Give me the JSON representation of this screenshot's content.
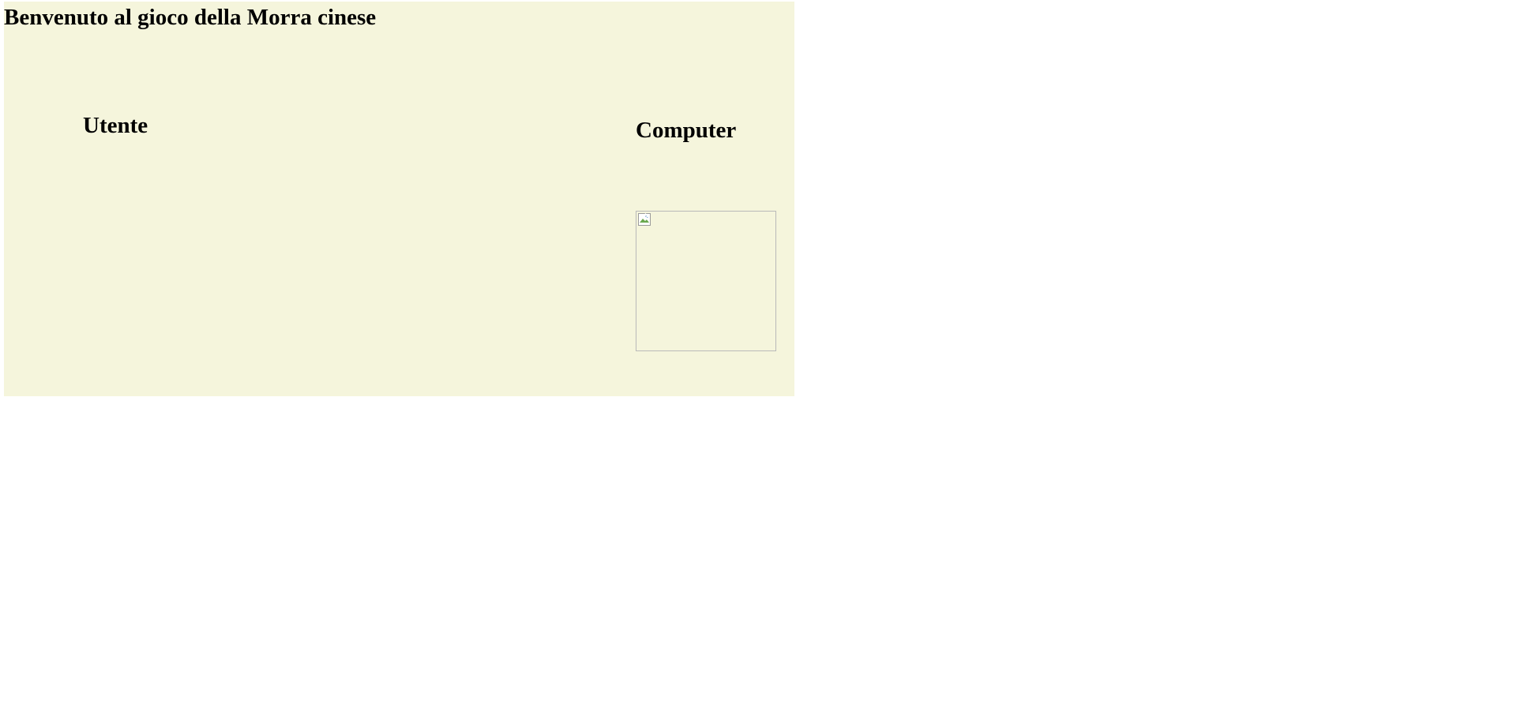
{
  "page": {
    "title": "Benvenuto al gioco della Morra cinese",
    "background_color": "#f5f5dc"
  },
  "player": {
    "heading": "Utente"
  },
  "computer": {
    "heading": "Computer",
    "choice_image_icon": "broken-image-icon"
  }
}
